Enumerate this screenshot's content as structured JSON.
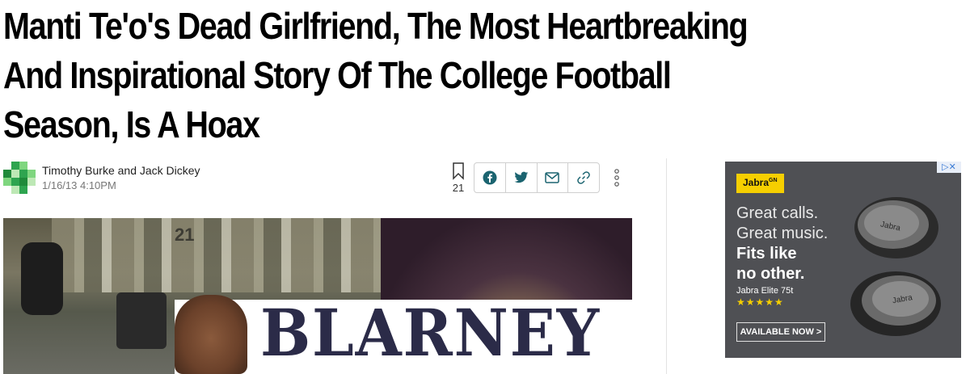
{
  "article": {
    "headline": "Manti Te'o's Dead Girlfriend, The Most Heartbreaking And Inspirational Story Of The College Football Season, Is A Hoax",
    "authors": "Timothy Burke and Jack Dickey",
    "date": "1/16/13 4:10PM",
    "bookmark_count": "21"
  },
  "hero": {
    "blarney_text": "BLARNEY",
    "jersey_text": "21"
  },
  "share": {
    "icons": [
      "facebook-icon",
      "twitter-icon",
      "email-icon",
      "link-icon"
    ]
  },
  "ad": {
    "brand": "Jabra",
    "brand_sup": "GN",
    "line1": "Great calls.",
    "line2": "Great music.",
    "line3": "Fits like",
    "line4": "no other.",
    "product": "Jabra Elite 75t",
    "stars": "★★★★★",
    "cta": "AVAILABLE NOW >",
    "earbud_brand": "Jabra"
  },
  "colors": {
    "share_icon": "#1b6470",
    "ad_background": "#4f5054",
    "ad_accent": "#f6cf00",
    "avatar_green": "#2ea44f"
  }
}
